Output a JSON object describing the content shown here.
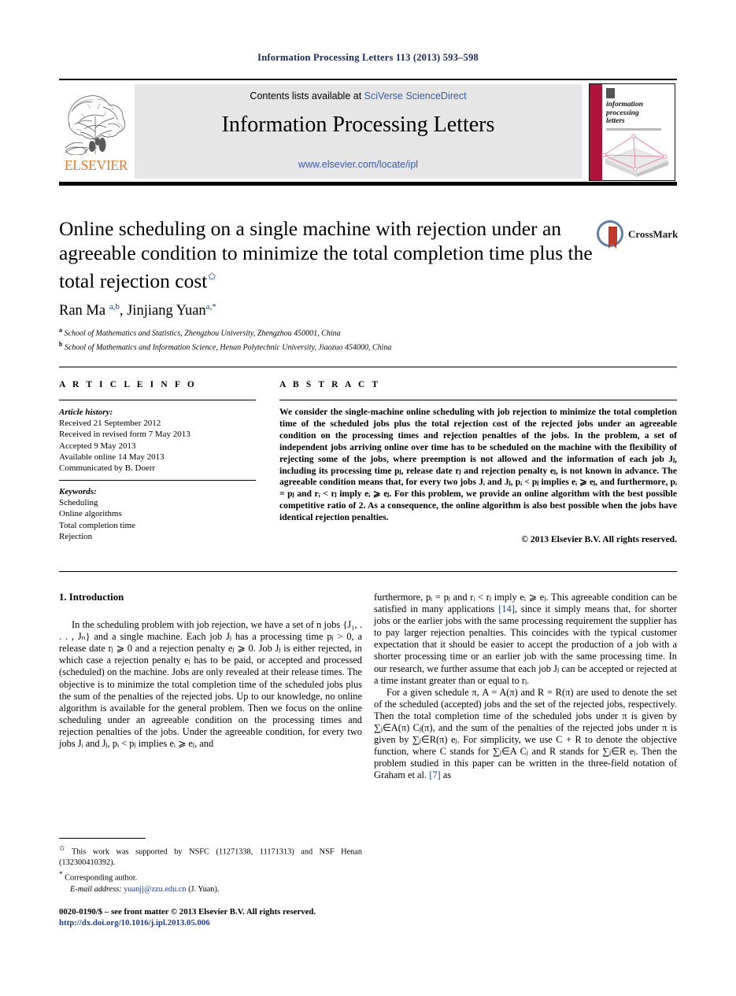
{
  "running_head": "Information Processing Letters 113 (2013) 593–598",
  "masthead": {
    "contents_prefix": "Contents lists available at ",
    "sciencedirect_link": "SciVerse ScienceDirect",
    "journal_title": "Information Processing Letters",
    "journal_url": "www.elsevier.com/locate/ipl",
    "publisher_name": "ELSEVIER",
    "cover_title_lines": [
      "information",
      "processing",
      "letters"
    ]
  },
  "article": {
    "title": "Online scheduling on a single machine with rejection under an agreeable condition to minimize the total completion time plus the total rejection cost",
    "title_footnote_marker": "✩",
    "crossmark_label": "CrossMark",
    "authors_html": "Ran Ma <sup>a,b</sup>, Jinjiang Yuan<sup>a,*</sup>",
    "affiliations": [
      {
        "marker": "a",
        "text": "School of Mathematics and Statistics, Zhengzhou University, Zhengzhou 450001, China"
      },
      {
        "marker": "b",
        "text": "School of Mathematics and Information Science, Henan Polytechnic University, Jiaozuo 454000, China"
      }
    ]
  },
  "article_info": {
    "heading": "A R T I C L E    I N F O",
    "history_label": "Article history:",
    "history": [
      "Received 21 September 2012",
      "Received in revised form 7 May 2013",
      "Accepted 9 May 2013",
      "Available online 14 May 2013",
      "Communicated by B. Doerr"
    ],
    "keywords_label": "Keywords:",
    "keywords": [
      "Scheduling",
      "Online algorithms",
      "Total completion time",
      "Rejection"
    ]
  },
  "abstract": {
    "heading": "A B S T R A C T",
    "text": "We consider the single-machine online scheduling with job rejection to minimize the total completion time of the scheduled jobs plus the total rejection cost of the rejected jobs under an agreeable condition on the processing times and rejection penalties of the jobs. In the problem, a set of independent jobs arriving online over time has to be scheduled on the machine with the flexibility of rejecting some of the jobs, where preemption is not allowed and the information of each job Jⱼ, including its processing time pⱼ, release date rⱼ and rejection penalty eⱼ, is not known in advance. The agreeable condition means that, for every two jobs Jᵢ and Jⱼ, pᵢ < pⱼ implies eᵢ ⩾ eⱼ, and furthermore, pᵢ = pⱼ and rᵢ < rⱼ imply eᵢ ⩾ eⱼ. For this problem, we provide an online algorithm with the best possible competitive ratio of 2. As a consequence, the online algorithm is also best possible when the jobs have identical rejection penalties.",
    "copyright": "© 2013 Elsevier B.V. All rights reserved."
  },
  "body": {
    "section_heading": "1. Introduction",
    "left_paragraphs": [
      "In the scheduling problem with job rejection, we have a set of n jobs {J₁, . . . , Jₙ} and a single machine. Each job Jⱼ has a processing time pⱼ > 0, a release date rⱼ ⩾ 0 and a rejection penalty eⱼ ⩾ 0. Job Jⱼ is either rejected, in which case a rejection penalty eⱼ has to be paid, or accepted and processed (scheduled) on the machine. Jobs are only revealed at their release times. The objective is to minimize the total completion time of the scheduled jobs plus the sum of the penalties of the rejected jobs. Up to our knowledge, no online algorithm is available for the general problem. Then we focus on the online scheduling under an agreeable condition on the processing times and rejection penalties of the jobs. Under the agreeable condition, for every two jobs Jᵢ and Jⱼ, pᵢ < pⱼ implies eᵢ ⩾ eⱼ, and"
    ],
    "right_paragraphs": [
      "furthermore, pᵢ = pⱼ and rᵢ < rⱼ imply eᵢ ⩾ eⱼ. This agreeable condition can be satisfied in many applications [14], since it simply means that, for shorter jobs or the earlier jobs with the same processing requirement the supplier has to pay larger rejection penalties. This coincides with the typical customer expectation that it should be easier to accept the production of a job with a shorter processing time or an earlier job with the same processing time. In our research, we further assume that each job Jⱼ can be accepted or rejected at a time instant greater than or equal to rⱼ.",
      "For a given schedule π, A = A(π) and R = R(π) are used to denote the set of the scheduled (accepted) jobs and the set of the rejected jobs, respectively. Then the total completion time of the scheduled jobs under π is given by ∑ⱼ∈A(π) Cⱼ(π), and the sum of the penalties of the rejected jobs under π is given by ∑ⱼ∈R(π) eⱼ. For simplicity, we use C + R to denote the objective function, where C stands for ∑ⱼ∈A Cⱼ and R stands for ∑ⱼ∈R eⱼ. Then the problem studied in this paper can be written in the three-field notation of Graham et al. [7] as"
    ],
    "reference_links": [
      "[14]",
      "[7]"
    ]
  },
  "footnotes": {
    "funding": "This work was supported by NSFC (11271338, 11171313) and NSF Henan (132300410392).",
    "funding_marker": "✩",
    "corresponding": "Corresponding author.",
    "corresponding_marker": "*",
    "email_label": "E-mail address:",
    "email_address": "yuanjj@zzu.edu.cn",
    "email_owner": "(J. Yuan)."
  },
  "imprint": {
    "issn_line": "0020-0190/$ – see front matter  © 2013 Elsevier B.V. All rights reserved.",
    "doi": "http://dx.doi.org/10.1016/j.ipl.2013.05.006"
  },
  "colors": {
    "elsevier_orange": "#e8792b",
    "link_blue": "#3b5ca8",
    "ref_blue": "#1c3f94",
    "runhead_navy": "#1c2a62",
    "banner_grey": "#e6e6e6",
    "cover_red": "#b0133a",
    "crossmark_red": "#c0392b"
  }
}
